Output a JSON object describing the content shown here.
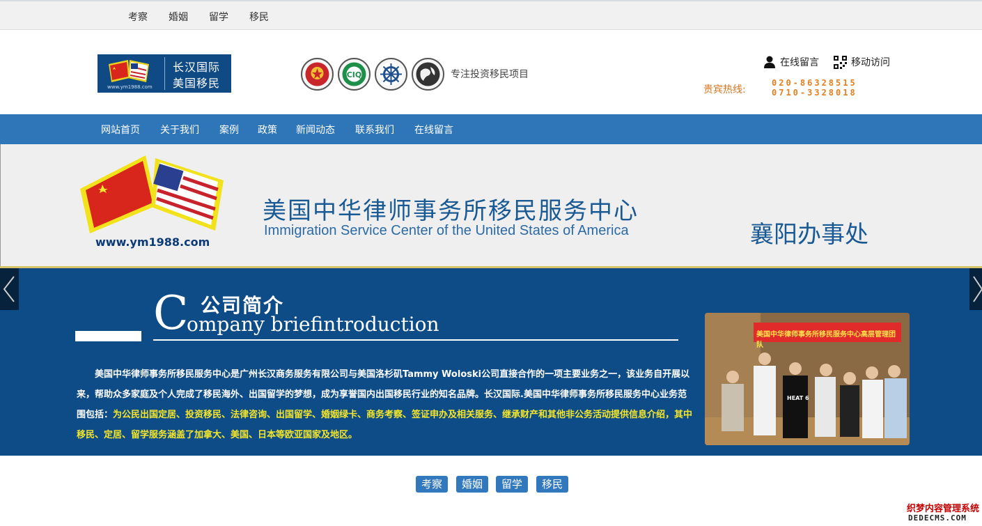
{
  "topbar": {
    "links": [
      "考察",
      "婚姻",
      "留学",
      "移民"
    ]
  },
  "header": {
    "logo": {
      "line1": "长汉国际",
      "line2": "美国移民",
      "url": "www.ym1988.com"
    },
    "slogan": "专注投资移民项目",
    "online_message": "在线留言",
    "mobile_visit": "移动访问",
    "hotline_label": "贵宾热线:",
    "hotlines": [
      "020-86328515",
      "0710-3328018"
    ]
  },
  "nav": {
    "items": [
      "网站首页",
      "关于我们",
      "案例",
      "政策",
      "新闻动态",
      "联系我们",
      "在线留言"
    ]
  },
  "banner1": {
    "cn_title": "美国中华律师事务所移民服务中心",
    "en_title": "Immigration Service Center of the United States of America",
    "office": "襄阳办事处",
    "url": "www.ym1988.com"
  },
  "banner2": {
    "big_c": "C",
    "cn_heading": "公司简介",
    "en_heading": "ompany  briefintroduction",
    "para_white": "美国中华律师事务所移民服务中心是广州长汉商务服务有限公司与美国洛杉矶Tammy Woloski公司直接合作的一项主要业务之一，该业务自开展以来，帮助众多家庭及个人完成了移民海外、出国留学的梦想，成为享誉国内出国移民行业的知名品牌。长汉国际.美国中华律师事务所移民服务中心业务范围包括：",
    "para_yellow": "为公民出国定居、投资移民、法律咨询、出国留学、婚姻绿卡、商务考察、签证申办及相关服务、继承财产和其他非公务活动提供信息介绍，其中移民、定居、留学服务涵盖了加拿大、美国、日本等欧亚国家及地区。",
    "photo_banner": "美国中华律师事务所移民服务中心高层管理团队",
    "photo_shirt": "HEAT 6"
  },
  "bottom_tabs": [
    "考察",
    "婚姻",
    "留学",
    "移民"
  ],
  "watermark": {
    "line1": "织梦内容管理系统",
    "line2": "DEDECMS.COM"
  },
  "colors": {
    "nav_bg": "#2f76b9",
    "banner_blue": "#0e4c87",
    "hotline": "#e27f1e",
    "highlight_text": "#f5e62a"
  }
}
